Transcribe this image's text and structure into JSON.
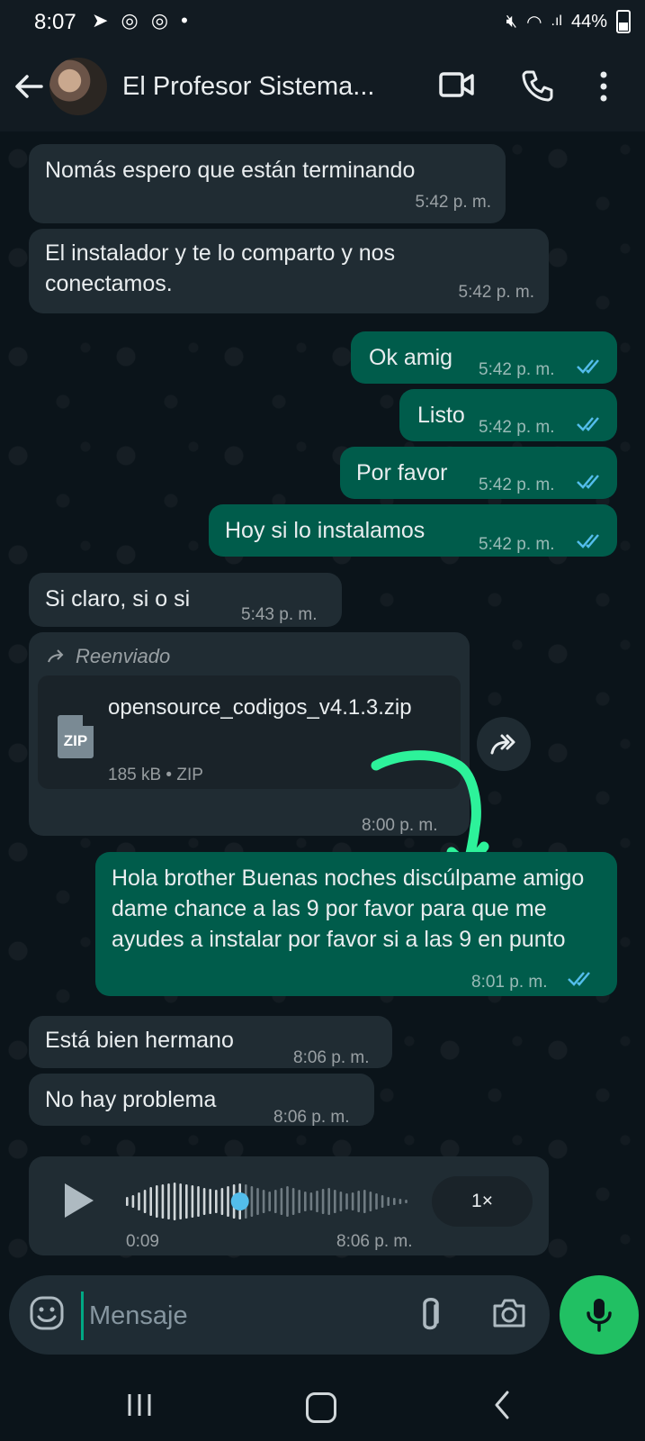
{
  "status_bar": {
    "time": "8:07",
    "battery": "44%"
  },
  "header": {
    "title": "El Profesor Sistema..."
  },
  "messages": [
    {
      "text": "Nomás espero que están terminando",
      "time": "5:42 p. m."
    },
    {
      "text": "El instalador y te lo comparto y nos conectamos.",
      "time": "5:42 p. m."
    },
    {
      "text": "Ok amig",
      "time": "5:42 p. m."
    },
    {
      "text": "Listo",
      "time": "5:42 p. m."
    },
    {
      "text": "Por favor",
      "time": "5:42 p. m."
    },
    {
      "text": "Hoy si lo instalamos",
      "time": "5:42 p. m."
    },
    {
      "text": "Si claro, si o si",
      "time": "5:43 p. m."
    },
    {
      "text": "Hola brother Buenas noches discúlpame amigo dame chance a las 9 por favor para que me ayudes a instalar por favor si a las 9 en punto",
      "time": "8:01 p. m."
    },
    {
      "text": "Está bien hermano",
      "time": "8:06 p. m."
    },
    {
      "text": "No hay problema",
      "time": "8:06 p. m."
    }
  ],
  "forwarded": {
    "label": "Reenviado",
    "file_name": "opensource_codigos_v4.1.3.zip",
    "file_meta": "185 kB • ZIP",
    "file_type": "ZIP",
    "time": "8:00 p. m."
  },
  "voice": {
    "duration": "0:09",
    "time": "8:06 p. m.",
    "speed": "1×",
    "progress": 0.4
  },
  "composer": {
    "placeholder": "Mensaje"
  },
  "colors": {
    "incoming": "#202c33",
    "outgoing": "#005c4b",
    "accent": "#21c063",
    "read_ticks": "#53bdeb"
  },
  "icons": [
    "back-arrow-icon",
    "video-call-icon",
    "phone-icon",
    "more-icon",
    "forward-icon",
    "zip-file-icon",
    "play-icon",
    "emoji-icon",
    "attach-icon",
    "camera-icon",
    "mic-icon"
  ]
}
